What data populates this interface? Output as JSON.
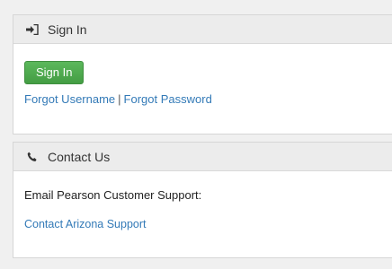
{
  "signin_panel": {
    "header_title": "Sign In",
    "header_icon": "sign-in-icon",
    "button_label": "Sign In",
    "forgot_username": "Forgot Username",
    "separator": "|",
    "forgot_password": "Forgot Password"
  },
  "contact_panel": {
    "header_title": "Contact Us",
    "header_icon": "phone-icon",
    "email_label": "Email Pearson Customer Support:",
    "contact_link": "Contact Arizona Support"
  },
  "colors": {
    "button_green": "#5cb85c",
    "link_blue": "#337ab7",
    "header_bg": "#ececec"
  }
}
